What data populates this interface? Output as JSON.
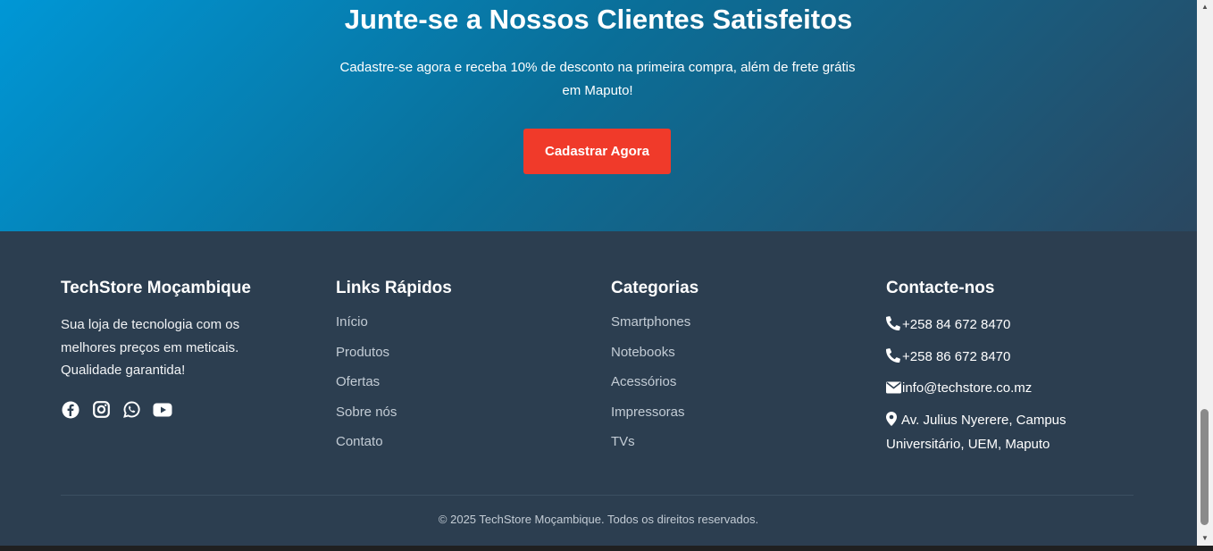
{
  "cta": {
    "title": "Junte-se a Nossos Clientes Satisfeitos",
    "text": "Cadastre-se agora e receba 10% de desconto na primeira compra, além de frete grátis em Maputo!",
    "button_label": "Cadastrar Agora",
    "button_color": "#f03a2a"
  },
  "footer": {
    "about": {
      "title": "TechStore Moçambique",
      "text": "Sua loja de tecnologia com os melhores preços em meticais. Qualidade garantida!",
      "socials": [
        "facebook-icon",
        "instagram-icon",
        "whatsapp-icon",
        "youtube-icon"
      ]
    },
    "quick_links": {
      "title": "Links Rápidos",
      "items": [
        "Início",
        "Produtos",
        "Ofertas",
        "Sobre nós",
        "Contato"
      ]
    },
    "categories": {
      "title": "Categorias",
      "items": [
        "Smartphones",
        "Notebooks",
        "Acessórios",
        "Impressoras",
        "TVs"
      ]
    },
    "contact": {
      "title": "Contacte-nos",
      "phone1": "+258 84 672 8470",
      "phone2": "+258 86 672 8470",
      "email": "info@techstore.co.mz",
      "address": "Av. Julius Nyerere, Campus Universitário, UEM, Maputo"
    },
    "copyright": "© 2025 TechStore Moçambique. Todos os direitos reservados."
  },
  "colors": {
    "footer_bg": "#2c3e50",
    "cta_gradient_start": "#0097d6",
    "cta_gradient_end": "#2a4760"
  }
}
